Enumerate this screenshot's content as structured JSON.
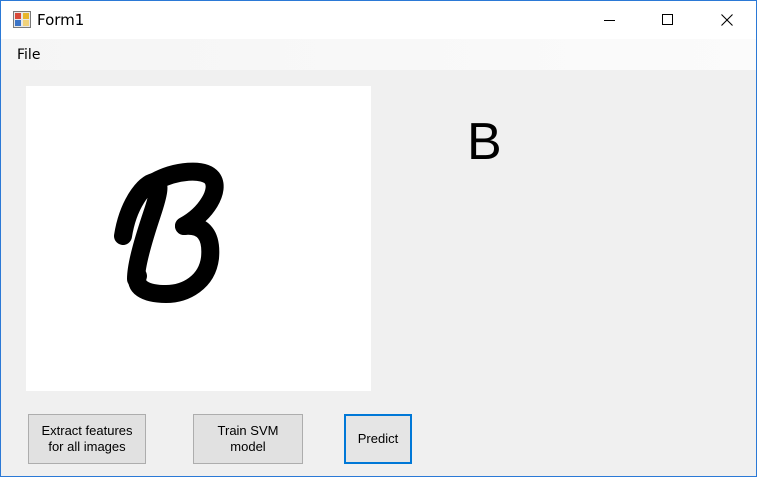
{
  "window": {
    "title": "Form1",
    "icons": {
      "app": "app-form-icon",
      "minimize": "minimize-icon",
      "maximize": "maximize-icon",
      "close": "close-icon"
    }
  },
  "menu": {
    "items": [
      {
        "label": "File"
      }
    ]
  },
  "main": {
    "image": {
      "content": "handwritten letter B"
    },
    "prediction": "B"
  },
  "buttons": {
    "extract_label": "Extract features\nfor all images",
    "train_label": "Train SVM\nmodel",
    "predict_label": "Predict"
  },
  "colors": {
    "window_border": "#2b79d6",
    "form_background": "#f0f0f0",
    "button_background": "#e1e1e1",
    "focus_border": "#0078d7"
  }
}
